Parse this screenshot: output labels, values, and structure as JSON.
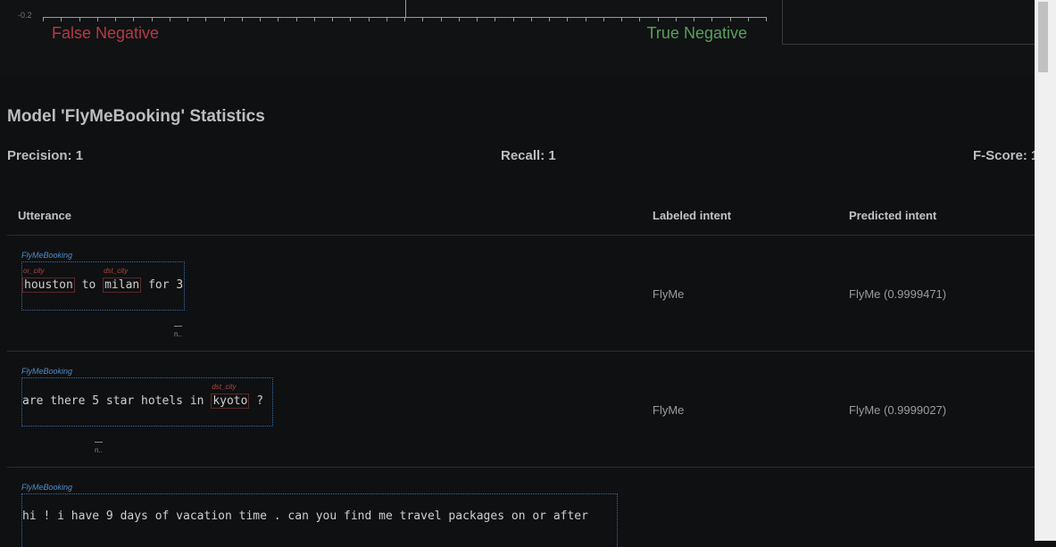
{
  "top_plot": {
    "y_tick_label": "-0.2",
    "false_negative_label": "False Negative",
    "true_negative_label": "True Negative"
  },
  "stats": {
    "title": "Model 'FlyMeBooking' Statistics",
    "precision": "Precision: 1",
    "recall": "Recall: 1",
    "fscore": "F-Score: 1"
  },
  "table": {
    "headers": [
      "Utterance",
      "Labeled intent",
      "Predicted intent"
    ],
    "rows": [
      {
        "intent_tag": "FlyMeBooking",
        "tokens": [
          {
            "text": "houston",
            "entity": "or_city"
          },
          {
            "text": "to",
            "entity": null
          },
          {
            "text": "milan",
            "entity": "dst_city"
          },
          {
            "text": "for 3",
            "entity": null
          }
        ],
        "marker": "n..",
        "labeled": "FlyMe",
        "predicted": "FlyMe (0.9999471)"
      },
      {
        "intent_tag": "FlyMeBooking",
        "tokens": [
          {
            "text": "are there 5 star hotels in",
            "entity": null
          },
          {
            "text": "kyoto",
            "entity": "dst_city"
          },
          {
            "text": "?",
            "entity": null
          }
        ],
        "marker": "n..",
        "labeled": "FlyMe",
        "predicted": "FlyMe (0.9999027)"
      },
      {
        "intent_tag": "FlyMeBooking",
        "text": "hi ! i have 9 days of vacation time . can you find me travel packages on or after"
      }
    ]
  }
}
